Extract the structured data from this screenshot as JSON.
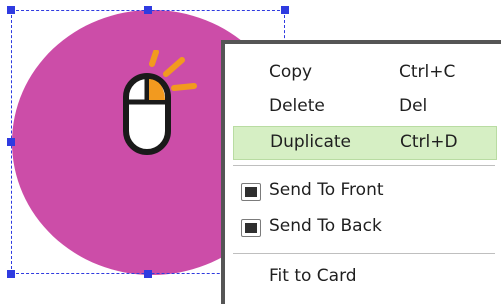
{
  "canvas": {
    "shape_color": "#cc4da8",
    "selection_color": "#2f3be0",
    "mouse_icon_name": "mouse-click-icon"
  },
  "context_menu": {
    "items": [
      {
        "label": "Copy",
        "shortcut": "Ctrl+C"
      },
      {
        "label": "Delete",
        "shortcut": "Del"
      },
      {
        "label": "Duplicate",
        "shortcut": "Ctrl+D",
        "highlighted": true
      },
      {
        "label": "Send To Front",
        "icon": "send-to-front-icon"
      },
      {
        "label": "Send To Back",
        "icon": "send-to-back-icon"
      },
      {
        "label": "Fit to Card"
      }
    ],
    "highlight_color": "#d6efc4"
  }
}
